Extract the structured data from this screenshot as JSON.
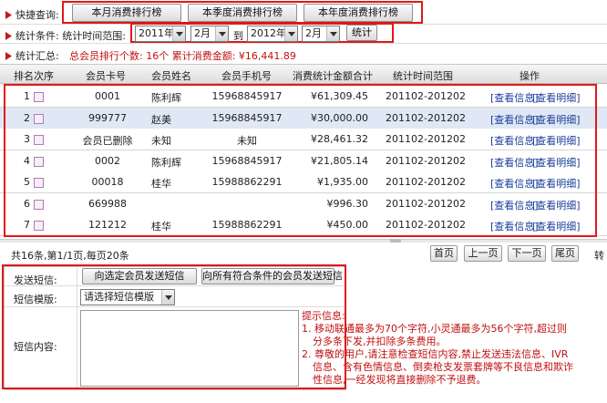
{
  "quick": {
    "label": "快捷查询:",
    "buttons": [
      "本月消费排行榜",
      "本季度消费排行榜",
      "本年度消费排行榜"
    ]
  },
  "filter": {
    "label": "统计条件: 统计时间范围:",
    "from_year": "2011年",
    "from_month": "2月",
    "to_label": "到",
    "to_year": "2012年",
    "to_month": "2月",
    "stat_button": "统计"
  },
  "summary": {
    "label": "统计汇总:",
    "text": "总会员排行个数: 16个    累计消费金额: ¥16,441.89"
  },
  "table": {
    "headers": [
      "排名次序",
      "会员卡号",
      "会员姓名",
      "会员手机号",
      "消费统计金额合计",
      "统计时间范围",
      "操作"
    ],
    "rows": [
      {
        "rank": "1",
        "card": "0001",
        "name": "陈利辉",
        "phone": "15968845917",
        "amount": "¥61,309.45",
        "range": "201102-201202"
      },
      {
        "rank": "2",
        "card": "999777",
        "name": "赵美",
        "phone": "15968845917",
        "amount": "¥30,000.00",
        "range": "201102-201202"
      },
      {
        "rank": "3",
        "card": "会员已删除",
        "name": "未知",
        "phone": "未知",
        "amount": "¥28,461.32",
        "range": "201102-201202"
      },
      {
        "rank": "4",
        "card": "0002",
        "name": "陈利辉",
        "phone": "15968845917",
        "amount": "¥21,805.14",
        "range": "201102-201202"
      },
      {
        "rank": "5",
        "card": "00018",
        "name": "桂华",
        "phone": "15988862291",
        "amount": "¥1,935.00",
        "range": "201102-201202"
      },
      {
        "rank": "6",
        "card": "669988",
        "name": "",
        "phone": "",
        "amount": "¥996.30",
        "range": "201102-201202"
      },
      {
        "rank": "7",
        "card": "121212",
        "name": "桂华",
        "phone": "15988862291",
        "amount": "¥450.00",
        "range": "201102-201202"
      }
    ],
    "op_view": "[查看信息]",
    "op_detail": "[查看明细]"
  },
  "pagination": {
    "info": "共16条,第1/1页,每页20条",
    "first": "首页",
    "prev": "上一页",
    "next": "下一页",
    "last": "尾页",
    "goto": "转"
  },
  "sms": {
    "send_label": "发送短信:",
    "btn_selected": "向选定会员发送短信",
    "btn_all": "向所有符合条件的会员发送短信",
    "template_label": "短信模版:",
    "template_value": "请选择短信模版",
    "content_label": "短信内容:",
    "tips_title": "提示信息:",
    "tip1_line1": "1. 移动联通最多为70个字符,小灵通最多为56个字符,超过则",
    "tip1_line2": "分多条下发,并扣除多条费用。",
    "tip2_line1": "2. 尊敬的用户,请注意检查短信内容,禁止发送违法信息、IVR",
    "tip2_line2": "信息、含有色情信息、倒卖枪支发票套牌等不良信息和欺诈",
    "tip2_line3": "性信息,一经发现将直接删除不予退费。"
  }
}
